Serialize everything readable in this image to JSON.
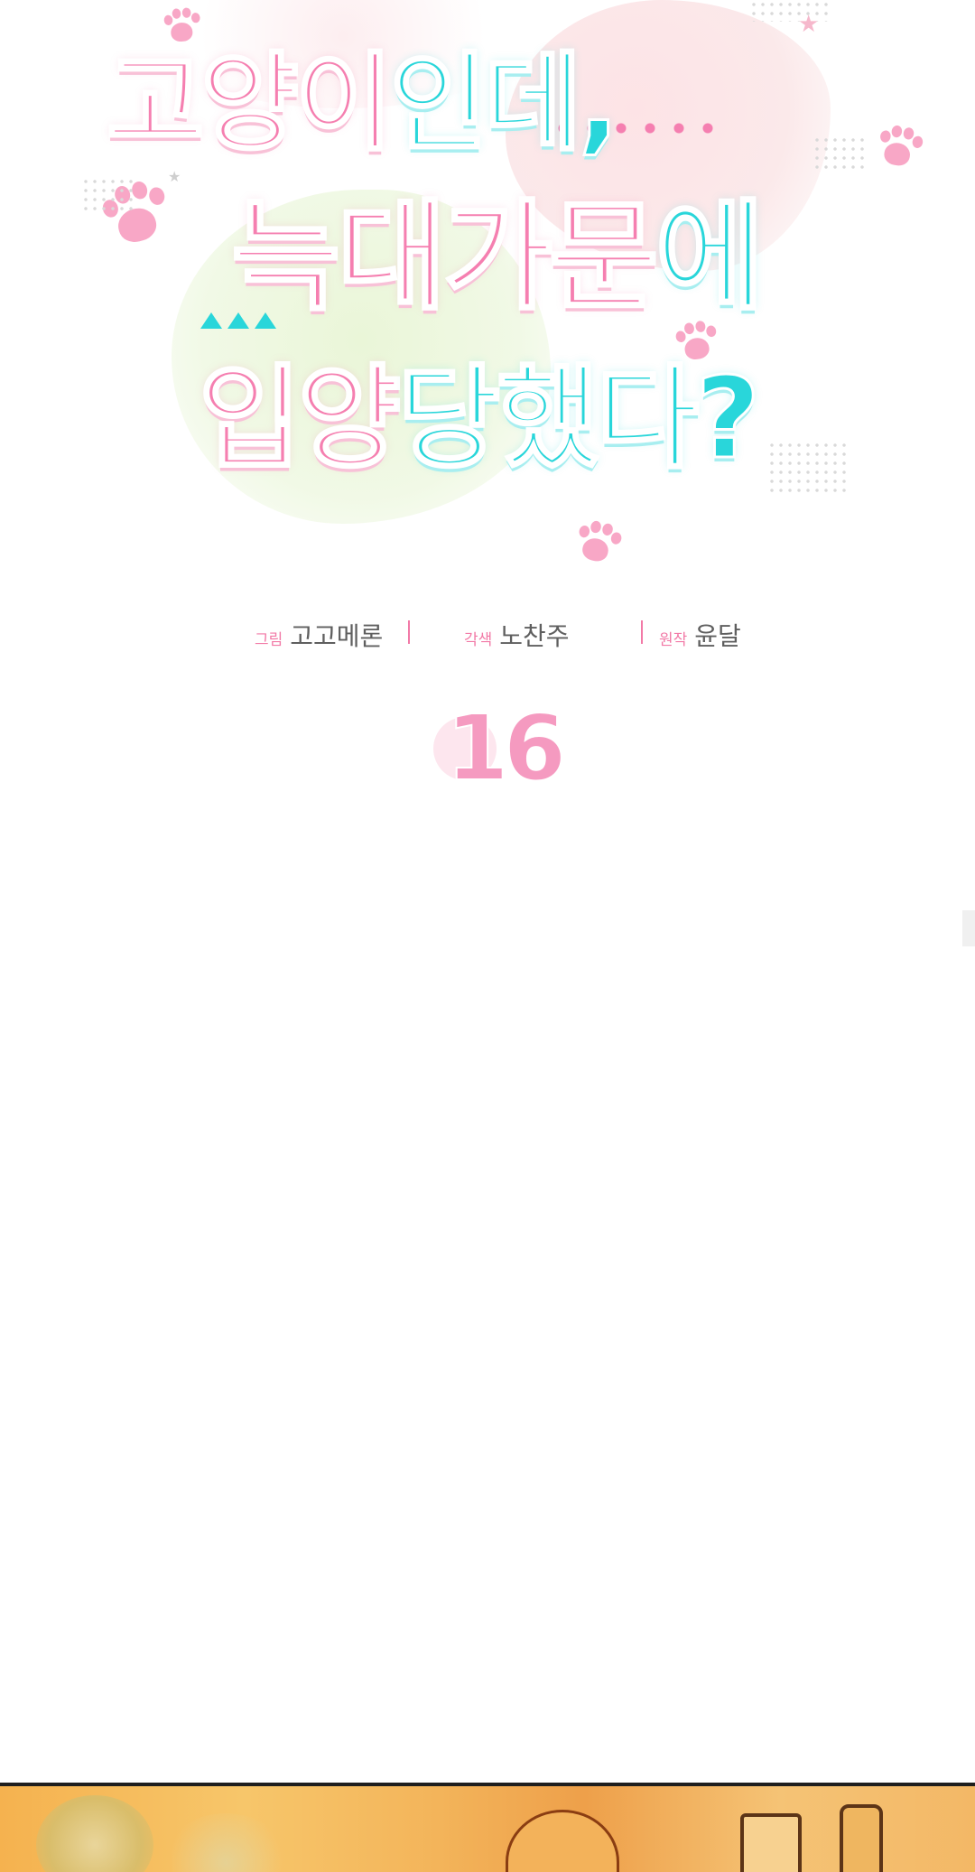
{
  "title": {
    "line1_pink": "고양이",
    "line1_cyan": "인데,",
    "line2_pink": "늑대가문",
    "line2_cyan": "에",
    "line3_pink": "입양",
    "line3_cyan": "당했다?"
  },
  "credits": {
    "art_role": "그림",
    "art_name": "고고메론",
    "adapt_role": "각색",
    "adapt_name": "노찬주",
    "original_role": "원작",
    "original_name": "윤달"
  },
  "episode": {
    "number": "16"
  },
  "colors": {
    "title_pink": "#f57fb0",
    "title_cyan": "#29d6da",
    "credit_role": "#f27aa7",
    "credit_name": "#5f5f5f",
    "episode": "#f59ac0"
  }
}
